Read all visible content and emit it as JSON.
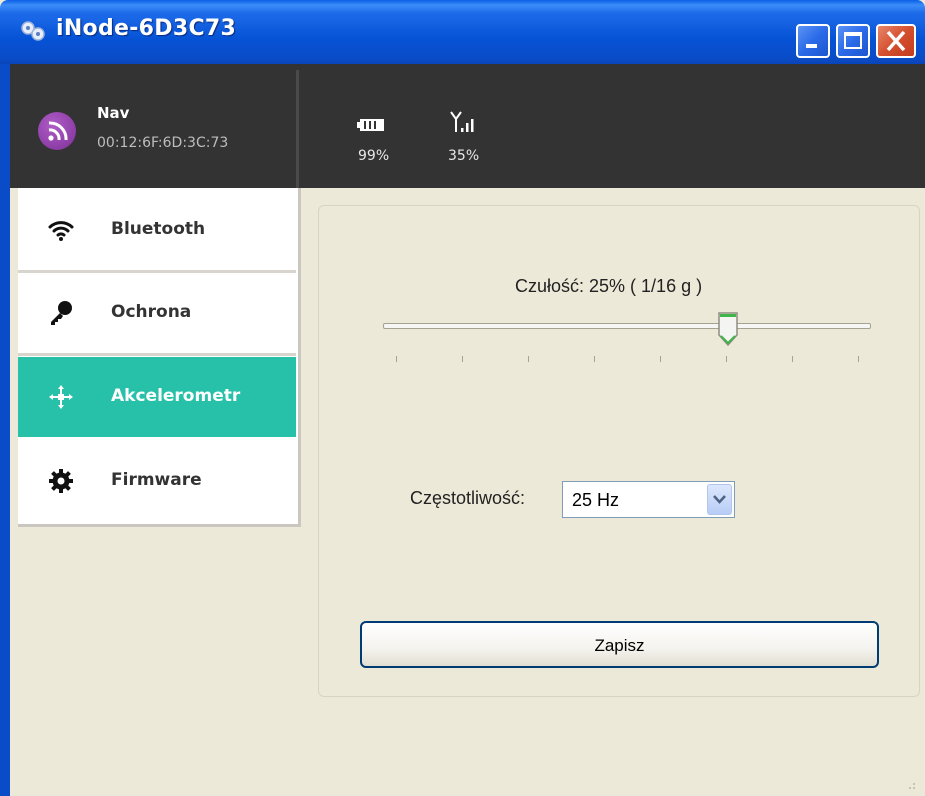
{
  "window": {
    "title": "iNode-6D3C73",
    "title_bar_color": "#0A4CC8",
    "buttons": [
      "minimize-icon",
      "maximize-icon",
      "close-icon"
    ]
  },
  "header": {
    "background": "#333333",
    "device": {
      "name": "Nav",
      "mac": "00:12:6F:6D:3C:73",
      "icon": "rss-icon",
      "icon_color": "#8B3BA8"
    },
    "battery": {
      "icon": "battery-icon",
      "value": "99%"
    },
    "signal": {
      "icon": "signal-antenna-icon",
      "value": "35%"
    }
  },
  "sidebar": {
    "items": [
      {
        "label": "Bluetooth",
        "icon": "wifi-icon",
        "active": false
      },
      {
        "label": "Ochrona",
        "icon": "key-icon",
        "active": false
      },
      {
        "label": "Akcelerometr",
        "icon": "move-arrows-icon",
        "active": true
      },
      {
        "label": "Firmware",
        "icon": "gear-icon",
        "active": false
      }
    ],
    "active_color": "#27C0A8"
  },
  "accelerometer": {
    "sensitivity_label": "Czułość: 25% ( 1/16 g )",
    "sensitivity_slider": {
      "position": 5,
      "max": 7
    },
    "frequency_label": "Częstotliwość:",
    "frequency_value": "25 Hz",
    "save_label": "Zapisz"
  }
}
